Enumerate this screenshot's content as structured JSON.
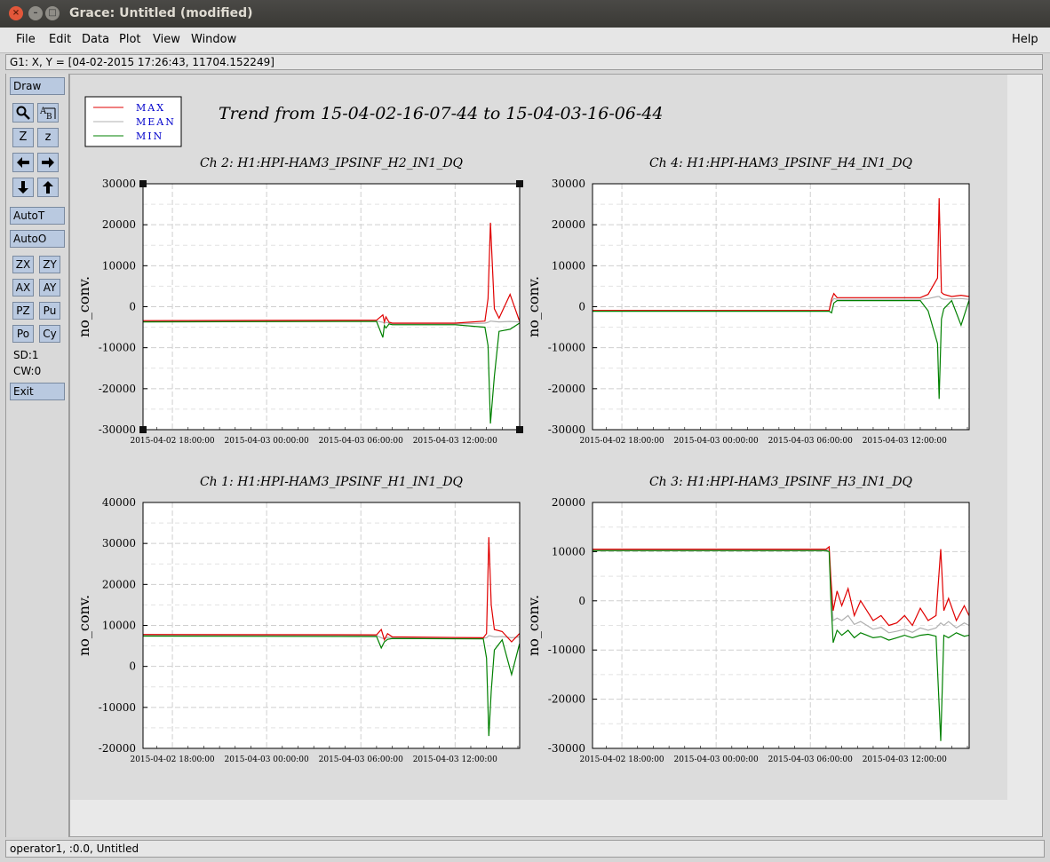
{
  "window": {
    "title": "Grace: Untitled (modified)"
  },
  "menu": {
    "file": "File",
    "edit": "Edit",
    "data": "Data",
    "plot": "Plot",
    "view": "View",
    "window": "Window",
    "help": "Help"
  },
  "locator": "G1: X, Y = [04-02-2015 17:26:43, 11704.152249]",
  "tools": {
    "draw": "Draw",
    "autot": "AutoT",
    "autoo": "AutoO",
    "zx": "ZX",
    "zy": "ZY",
    "ax": "AX",
    "ay": "AY",
    "pz": "PZ",
    "pu": "Pu",
    "po": "Po",
    "cy": "Cy",
    "sd": "SD:1",
    "cw": "CW:0",
    "exit": "Exit",
    "zoom_big": "Z",
    "zoom_small": "z",
    "icons": [
      "zoom-icon",
      "autoscale-text-icon",
      "arrow-left-icon",
      "arrow-right-icon",
      "arrow-down-icon",
      "arrow-up-icon"
    ]
  },
  "statusbar": "operator1, :0.0, Untitled",
  "colors": {
    "max": "#e00000",
    "mean": "#b0b0b0",
    "min": "#008000",
    "legend_text": "#0000cc"
  },
  "chart_data": {
    "type": "line",
    "title": "Trend from 15-04-02-16-07-44 to 15-04-03-16-06-44",
    "legend": [
      "MAX",
      "MEAN",
      "MIN"
    ],
    "legend_placement": "top-left",
    "x_tick_labels": [
      "2015-04-02 18:00:00",
      "2015-04-03 00:00:00",
      "2015-04-03 06:00:00",
      "2015-04-03 12:00:00"
    ],
    "x_tick_hours": [
      18,
      24,
      30,
      36
    ],
    "xlim_hours": [
      16.1289,
      40.1122
    ],
    "grid": true,
    "panels": [
      {
        "title": "Ch 2: H1:HPI-HAM3_IPSINF_H2_IN1_DQ",
        "ylabel": "no_conv.",
        "ylim": [
          -30000,
          30000
        ],
        "y_ticks": [
          -30000,
          -20000,
          -10000,
          0,
          10000,
          20000,
          30000
        ],
        "tick_labels": [
          "-30000",
          "-20000",
          "-10000",
          "0",
          "10000",
          "20000",
          "30000"
        ],
        "x": [
          16.13,
          31.0,
          31.4,
          31.5,
          31.6,
          31.8,
          32.0,
          36.0,
          37.9,
          38.1,
          38.25,
          38.5,
          38.8,
          39.5,
          40.1
        ],
        "series": [
          {
            "name": "MAX",
            "values": [
              -3400,
              -3300,
              -2000,
              -3700,
              -2500,
              -3800,
              -4000,
              -4000,
              -3500,
              2000,
              20500,
              -500,
              -2800,
              3000,
              -3500
            ]
          },
          {
            "name": "MEAN",
            "values": [
              -3600,
              -3500,
              -3800,
              -4100,
              -3800,
              -4000,
              -4200,
              -4200,
              -4000,
              -3800,
              -3500,
              -3600,
              -3700,
              -3600,
              -3700
            ]
          },
          {
            "name": "MIN",
            "values": [
              -3700,
              -3600,
              -7500,
              -4600,
              -5200,
              -4200,
              -4400,
              -4400,
              -5000,
              -9500,
              -28500,
              -17000,
              -6000,
              -5500,
              -4000
            ]
          }
        ]
      },
      {
        "title": "Ch 4: H1:HPI-HAM3_IPSINF_H4_IN1_DQ",
        "ylabel": "no_conv.",
        "ylim": [
          -30000,
          30000
        ],
        "y_ticks": [
          -30000,
          -20000,
          -10000,
          0,
          10000,
          20000,
          30000
        ],
        "tick_labels": [
          "-30000",
          "-20000",
          "-10000",
          "0",
          "10000",
          "20000",
          "30000"
        ],
        "x": [
          16.13,
          31.2,
          31.35,
          31.5,
          31.7,
          32.0,
          37.0,
          37.5,
          38.1,
          38.2,
          38.35,
          38.5,
          39.0,
          39.6,
          40.1
        ],
        "series": [
          {
            "name": "MAX",
            "values": [
              -900,
              -900,
              1800,
              3200,
              2200,
              2200,
              2200,
              3000,
              7000,
              26500,
              3500,
              3000,
              2500,
              2800,
              2500
            ]
          },
          {
            "name": "MEAN",
            "values": [
              -1000,
              -1000,
              1200,
              2000,
              1800,
              1800,
              1800,
              2000,
              2500,
              2500,
              2000,
              1800,
              1900,
              2000,
              1800
            ]
          },
          {
            "name": "MIN",
            "values": [
              -1100,
              -1100,
              -1500,
              900,
              1500,
              1500,
              1500,
              -1000,
              -9000,
              -22500,
              -3000,
              -500,
              1500,
              -4500,
              1500
            ]
          }
        ]
      },
      {
        "title": "Ch 1: H1:HPI-HAM3_IPSINF_H1_IN1_DQ",
        "ylabel": "no_conv.",
        "ylim": [
          -20000,
          40000
        ],
        "y_ticks": [
          -20000,
          -10000,
          0,
          10000,
          20000,
          30000,
          40000
        ],
        "tick_labels": [
          "-20000",
          "-10000",
          "0",
          "10000",
          "20000",
          "30000",
          "40000"
        ],
        "x": [
          16.13,
          31.0,
          31.3,
          31.5,
          31.7,
          32.0,
          37.8,
          38.0,
          38.15,
          38.3,
          38.5,
          39.0,
          39.6,
          40.1
        ],
        "series": [
          {
            "name": "MAX",
            "values": [
              7800,
              7700,
              9000,
              6500,
              8000,
              7200,
              7000,
              8000,
              31500,
              15000,
              9000,
              8500,
              6000,
              8000
            ]
          },
          {
            "name": "MEAN",
            "values": [
              7600,
              7500,
              7000,
              6700,
              7100,
              7000,
              6900,
              7000,
              7500,
              7400,
              7200,
              7300,
              7000,
              7200
            ]
          },
          {
            "name": "MIN",
            "values": [
              7400,
              7300,
              4500,
              6000,
              6600,
              6800,
              6700,
              2000,
              -17000,
              -6000,
              4000,
              6500,
              -2000,
              5500
            ]
          }
        ]
      },
      {
        "title": "Ch 3: H1:HPI-HAM3_IPSINF_H3_IN1_DQ",
        "ylabel": "no_conv.",
        "ylim": [
          -30000,
          20000
        ],
        "y_ticks": [
          -30000,
          -20000,
          -10000,
          0,
          10000,
          20000
        ],
        "tick_labels": [
          "-30000",
          "-20000",
          "-10000",
          "0",
          "10000",
          "20000"
        ],
        "x": [
          16.13,
          31.0,
          31.2,
          31.3,
          31.45,
          31.7,
          32.0,
          32.4,
          32.8,
          33.2,
          33.6,
          34.0,
          34.5,
          35.0,
          35.5,
          36.0,
          36.5,
          37.0,
          37.5,
          38.0,
          38.3,
          38.5,
          38.8,
          39.3,
          39.8,
          40.1
        ],
        "series": [
          {
            "name": "MAX",
            "values": [
              10500,
              10500,
              11000,
              5000,
              -2000,
              2000,
              -1000,
              2500,
              -3000,
              0,
              -2000,
              -4000,
              -3000,
              -5000,
              -4500,
              -3000,
              -5000,
              -1500,
              -4000,
              -3000,
              10500,
              -2000,
              500,
              -4000,
              -1000,
              -3000
            ]
          },
          {
            "name": "MEAN",
            "values": [
              10300,
              10300,
              10400,
              3000,
              -4000,
              -3500,
              -4000,
              -3000,
              -4800,
              -4200,
              -5000,
              -5800,
              -5400,
              -6500,
              -6200,
              -5800,
              -6400,
              -5500,
              -6000,
              -5500,
              -4500,
              -5000,
              -4200,
              -5500,
              -4500,
              -5000
            ]
          },
          {
            "name": "MIN",
            "values": [
              10200,
              10200,
              10000,
              1000,
              -8500,
              -6000,
              -7000,
              -6000,
              -7500,
              -6500,
              -7000,
              -7500,
              -7300,
              -8000,
              -7500,
              -7000,
              -7500,
              -7000,
              -6800,
              -7200,
              -28500,
              -7000,
              -7500,
              -6500,
              -7200,
              -7000
            ]
          }
        ]
      }
    ]
  }
}
